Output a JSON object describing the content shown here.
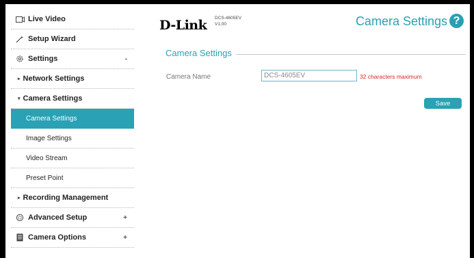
{
  "sidebar": {
    "live_video": "Live Video",
    "setup_wizard": "Setup Wizard",
    "settings": "Settings",
    "settings_toggle": "-",
    "network_settings": "Network Settings",
    "camera_settings": "Camera Settings",
    "camera_settings_children": [
      {
        "label": "Camera Settings",
        "active": true
      },
      {
        "label": "Image Settings",
        "active": false
      },
      {
        "label": "Video Stream",
        "active": false
      },
      {
        "label": "Preset Point",
        "active": false
      }
    ],
    "recording_management": "Recording Management",
    "advanced_setup": "Advanced Setup",
    "advanced_toggle": "+",
    "camera_options": "Camera Options",
    "camera_options_toggle": "+"
  },
  "header": {
    "brand": "D-Link",
    "model": "DCS-4605EV",
    "version": "V1.00",
    "title": "Camera Settings",
    "help_label": "?"
  },
  "main": {
    "section_title": "Camera Settings",
    "camera_name_label": "Camera Name",
    "camera_name_value": "DCS-4605EV",
    "camera_name_hint": "32 characters maximum",
    "save_label": "Save"
  },
  "colors": {
    "accent": "#2aa1b5",
    "hint": "#e02020"
  }
}
